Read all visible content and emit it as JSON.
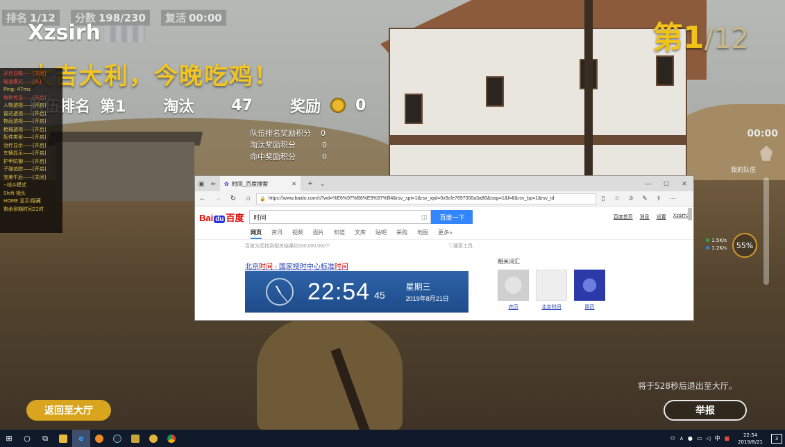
{
  "hud": {
    "rank_label": "排名",
    "rank_value": "1/12",
    "score_label": "分数",
    "score_value": "198/230",
    "revive_label": "复活",
    "revive_value": "00:00",
    "player_name": "Xzsirh",
    "win_message": "大吉大利，今晚吃鸡！",
    "team_rank_label": "队伍排名",
    "team_rank_value": "第1",
    "kills_label": "淘汰",
    "kills_value": "47",
    "reward_label": "奖励",
    "reward_value": "0",
    "rewards": [
      {
        "label": "队伍排名奖励积分",
        "value": "0"
      },
      {
        "label": "淘汰奖励积分",
        "value": "0"
      },
      {
        "label": "命中奖励积分",
        "value": "0"
      }
    ],
    "place": "第1",
    "place_total": "/12",
    "timer_right": "00:00",
    "my_team": "我的队伍",
    "gauge_percent": "55%",
    "speed_up": "1.5",
    "speed_down": "1.2",
    "speed_unit": "K/s",
    "exit_note": "将于528秒后退出至大厅。",
    "back_button": "返回至大厅",
    "report_button": "举报",
    "colors": {
      "accent_yellow": "#f3c521",
      "button_gold": "#d9a51e"
    }
  },
  "cheat_menu": [
    {
      "text": "开启自瞄——[关闭]",
      "red": true
    },
    {
      "text": "瞄准模式——[头]",
      "red": true
    },
    {
      "text": "Ping: 47ms",
      "red": false
    },
    {
      "text": "每秒传送——[开启]",
      "red": true
    },
    {
      "text": "人物透视——[开启]",
      "red": false
    },
    {
      "text": "雷达透视——[开启]",
      "red": false
    },
    {
      "text": "物品透视——[开启]",
      "red": false
    },
    {
      "text": "枪械透视——[开启]",
      "red": false
    },
    {
      "text": "配件类型——[开启]",
      "red": false
    },
    {
      "text": "治疗显示——[开启]",
      "red": false
    },
    {
      "text": "车辆显示——[开启]",
      "red": false
    },
    {
      "text": "护甲防御——[开启]",
      "red": false
    },
    {
      "text": "子弹追踪——[开启]",
      "red": false
    },
    {
      "text": "完美午后——[关闭]",
      "red": false
    },
    {
      "text": "--线斗模式",
      "red": false
    },
    {
      "text": "Shift 锁头",
      "red": false
    },
    {
      "text": "HOME 显示/隐藏",
      "red": false
    },
    {
      "text": "剩余到期时间22时",
      "red": false
    }
  ],
  "browser": {
    "tab_title": "时间_百度搜索",
    "url": "https://www.baidu.com/s?wd=%E6%97%B6%E9%97%B4&rsv_spt=1&rsv_iqid=0x9cfe7697000a3a86&issp=1&f=8&rsv_bp=1&rsv_id",
    "search_value": "时间",
    "search_button": "百度一下",
    "top_links": [
      "百度首页",
      "消息",
      "设置",
      "Xzsirh1"
    ],
    "tabs": [
      "网页",
      "资讯",
      "视频",
      "图片",
      "知道",
      "文库",
      "贴吧",
      "采购",
      "地图",
      "更多»"
    ],
    "result_count": "百度为您找到相关结果约100,000,000个",
    "search_tools": "搜索工具",
    "result_title_prefix": "北京",
    "result_title_hl": "时间",
    "result_title_mid": " - 国家授时中心标准",
    "result_title_end": "时间",
    "clock_time": "22:54",
    "clock_seconds": "45",
    "weekday": "星期三",
    "date": "2019年8月21日",
    "related_title": "相关词汇",
    "related": [
      "农历",
      "北京时间",
      "阴历"
    ]
  },
  "taskbar": {
    "time": "22:54",
    "date": "2019/8/21",
    "ime": "中",
    "notifications": "3"
  }
}
